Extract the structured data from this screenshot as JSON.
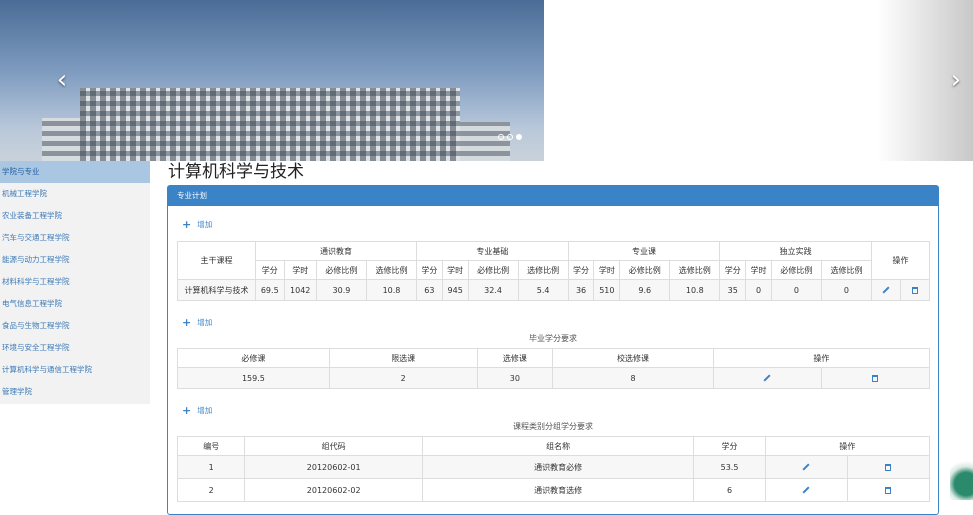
{
  "carousel": {
    "prev": "‹",
    "next": "›",
    "slides": 3,
    "active_slide": 3
  },
  "sidebar": {
    "items": [
      {
        "label": "学院与专业",
        "active": true
      },
      {
        "label": "机械工程学院"
      },
      {
        "label": "农业装备工程学院"
      },
      {
        "label": "汽车与交通工程学院"
      },
      {
        "label": "能源与动力工程学院"
      },
      {
        "label": "材料科学与工程学院"
      },
      {
        "label": "电气信息工程学院"
      },
      {
        "label": "食品与生物工程学院"
      },
      {
        "label": "环境与安全工程学院"
      },
      {
        "label": "计算机科学与通信工程学院"
      },
      {
        "label": "管理学院"
      }
    ]
  },
  "page_title": "计算机科学与技术",
  "panel": {
    "header": "专业计划",
    "add_label": "增加"
  },
  "plan_table": {
    "col_main": "主干课程",
    "groups": [
      "通识教育",
      "专业基础",
      "专业课",
      "独立实践"
    ],
    "sub_headers": [
      "学分",
      "学时",
      "必修比例",
      "选修比例"
    ],
    "col_action": "操作",
    "row": {
      "name": "计算机科学与技术",
      "values": [
        "69.5",
        "1042",
        "30.9",
        "10.8",
        "63",
        "945",
        "32.4",
        "5.4",
        "36",
        "510",
        "9.6",
        "10.8",
        "35",
        "0",
        "0",
        "0"
      ]
    }
  },
  "credits_table": {
    "caption": "毕业学分要求",
    "headers": [
      "必修课",
      "限选课",
      "选修课",
      "校选修课",
      "操作"
    ],
    "row": [
      "159.5",
      "2",
      "30",
      "8"
    ]
  },
  "group_table": {
    "caption": "课程类别分组学分要求",
    "headers": [
      "编号",
      "组代码",
      "组名称",
      "学分",
      "操作"
    ],
    "rows": [
      [
        "1",
        "20120602-01",
        "通识教育必修",
        "53.5"
      ],
      [
        "2",
        "20120602-02",
        "通识教育选修",
        "6"
      ]
    ]
  },
  "colors": {
    "accent": "#3b83c7",
    "sidebar_active": "#a9c6e3"
  },
  "icons": {
    "edit": "pencil-icon",
    "delete": "trash-icon",
    "add": "plus-icon"
  }
}
